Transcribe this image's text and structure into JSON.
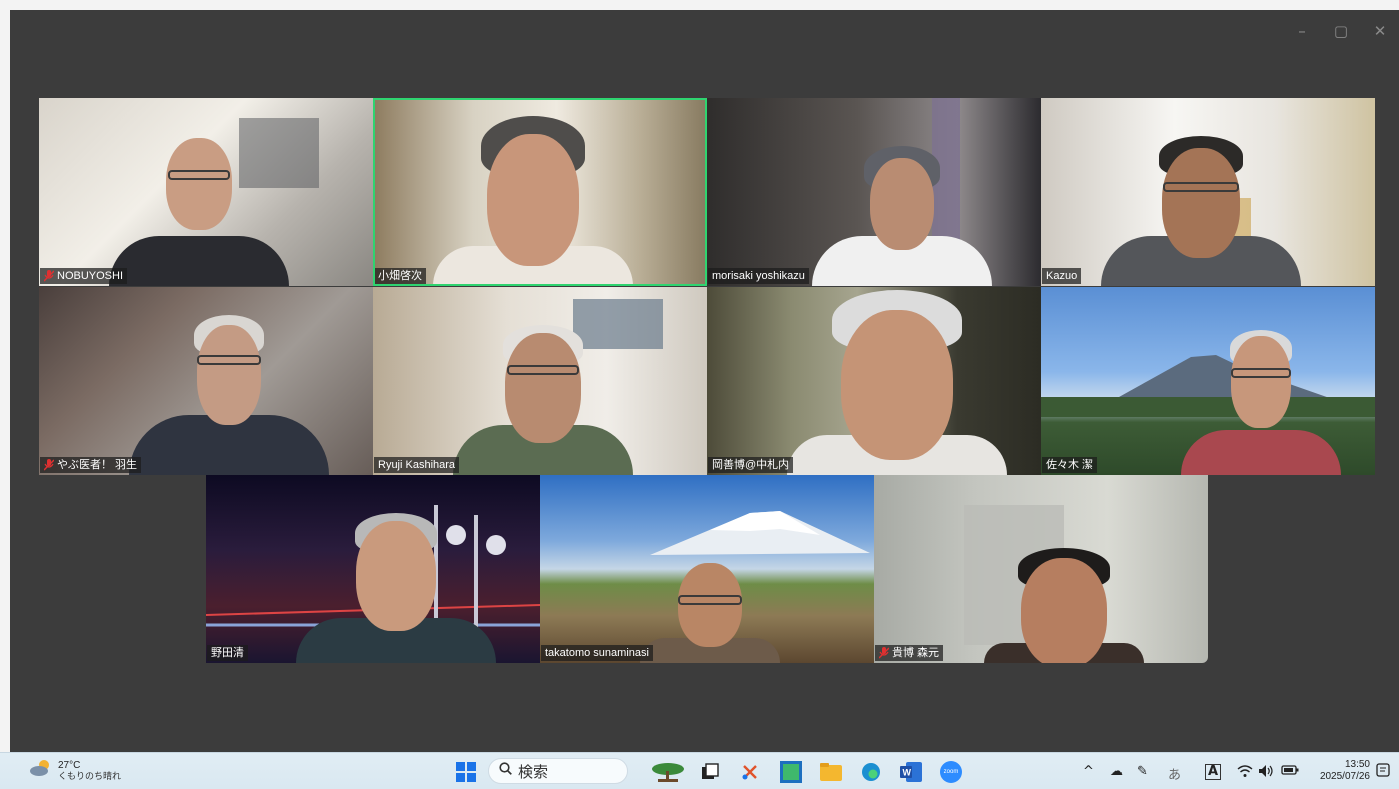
{
  "window": {
    "minimize_icon": "–",
    "maximize_icon": "▢",
    "close_icon": "✕"
  },
  "participants": [
    {
      "name": "NOBUYOSHI",
      "muted": true,
      "active": false
    },
    {
      "name": "小畑啓次",
      "muted": false,
      "active": true
    },
    {
      "name": "morisaki yoshikazu",
      "muted": false,
      "active": false
    },
    {
      "name": "Kazuo",
      "muted": false,
      "active": false
    },
    {
      "name": "やぶ医者！ 羽生",
      "muted": true,
      "active": false
    },
    {
      "name": "Ryuji Kashihara",
      "muted": false,
      "active": false
    },
    {
      "name": "岡善博@中札内",
      "muted": false,
      "active": false
    },
    {
      "name": "佐々木 潔",
      "muted": false,
      "active": false
    },
    {
      "name": "野田清",
      "muted": false,
      "active": false
    },
    {
      "name": "takatomo sunaminasi",
      "muted": false,
      "active": false
    },
    {
      "name": "貴博 森元",
      "muted": true,
      "active": false
    }
  ],
  "taskbar": {
    "weather": {
      "temp": "27°C",
      "desc": "くもりのち晴れ"
    },
    "search_label": "検索",
    "apps": [
      "start-icon",
      "search",
      "bonsai-app-icon",
      "task-view-icon",
      "snipping-tool-icon",
      "photos-app-icon",
      "file-explorer-icon",
      "edge-icon",
      "word-icon",
      "zoom-icon"
    ],
    "zoom_label": "zoom",
    "tray": {
      "chevron": "^",
      "ime": "あ",
      "font_app": "A",
      "time": "13:50",
      "date": "2025/07/26"
    }
  }
}
